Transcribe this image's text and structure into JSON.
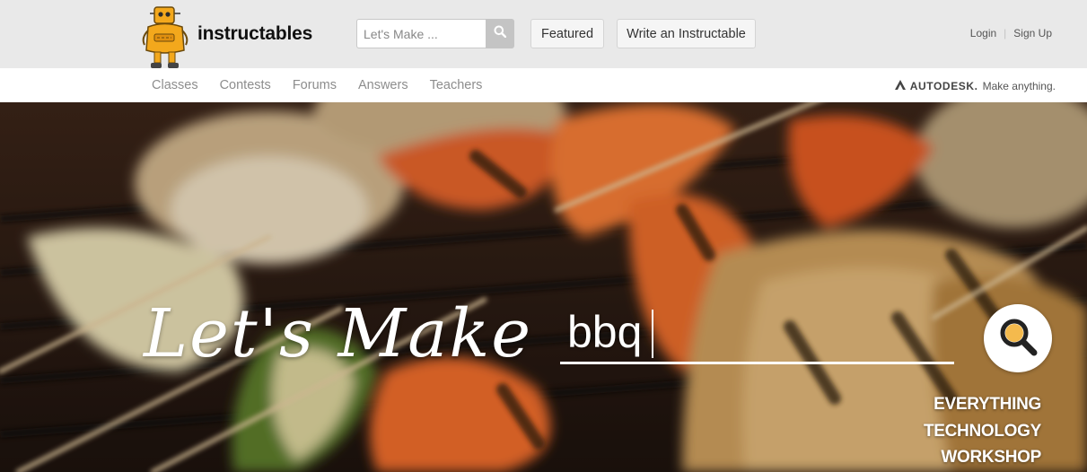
{
  "header": {
    "logo_icon": "robot-mascot-icon",
    "brand": "instructables",
    "search": {
      "placeholder": "Let's Make ...",
      "value": "",
      "button_icon": "search-icon"
    },
    "featured_label": "Featured",
    "write_label": "Write an Instructable",
    "login_label": "Login",
    "signup_label": "Sign Up"
  },
  "nav": {
    "items": [
      "Classes",
      "Contests",
      "Forums",
      "Answers",
      "Teachers"
    ]
  },
  "sponsor": {
    "logo_icon": "autodesk-logo-icon",
    "name": "AUTODESK.",
    "tagline": "Make anything."
  },
  "hero": {
    "title": "Let's Make",
    "search_value": "bbq",
    "search_button_icon": "search-icon",
    "categories": [
      "EVERYTHING",
      "TECHNOLOGY",
      "WORKSHOP"
    ]
  },
  "colors": {
    "header_bg": "#e9e9e9",
    "nav_text": "#8d8d8d",
    "hero_text": "#ffffff",
    "mascot": "#f3a81c"
  }
}
